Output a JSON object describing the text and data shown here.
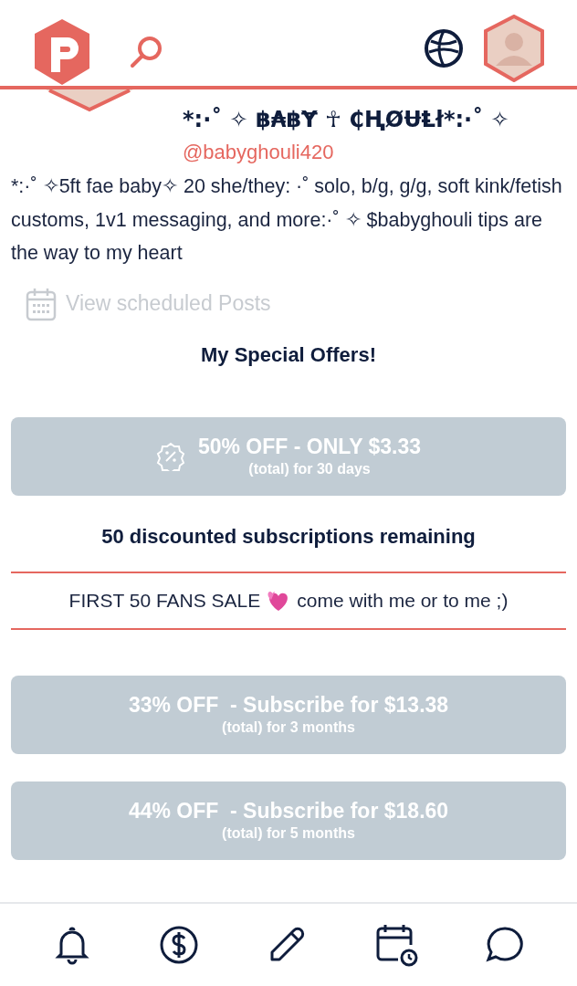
{
  "profile": {
    "name": "*:·˚ ✧ ฿₳฿Ɏ ☥ ₵ⱧØɄⱠł*:·˚ ✧",
    "handle": "@babyghouli420",
    "bio": "*:·˚ ✧5ft fae baby✧ 20 she/they: ·˚ solo, b/g, g/g, soft kink/fetish customs, 1v1 messaging, and more:·˚ ✧ $babyghouli tips are the way to my heart"
  },
  "scheduled_link": "View scheduled Posts",
  "offers_title": "My Special Offers!",
  "promo": {
    "title": "50% OFF - ONLY $3.33",
    "subtitle": "(total) for 30 days",
    "remaining": "50 discounted subscriptions remaining",
    "message_start": "FIRST 50 FANS SALE",
    "message_end": "come with me or to me ;)"
  },
  "bundles": [
    {
      "title": "33% OFF  - Subscribe for $13.38",
      "subtitle": "(total) for 3 months"
    },
    {
      "title": "44% OFF  - Subscribe for $18.60",
      "subtitle": "(total) for 5 months"
    }
  ]
}
